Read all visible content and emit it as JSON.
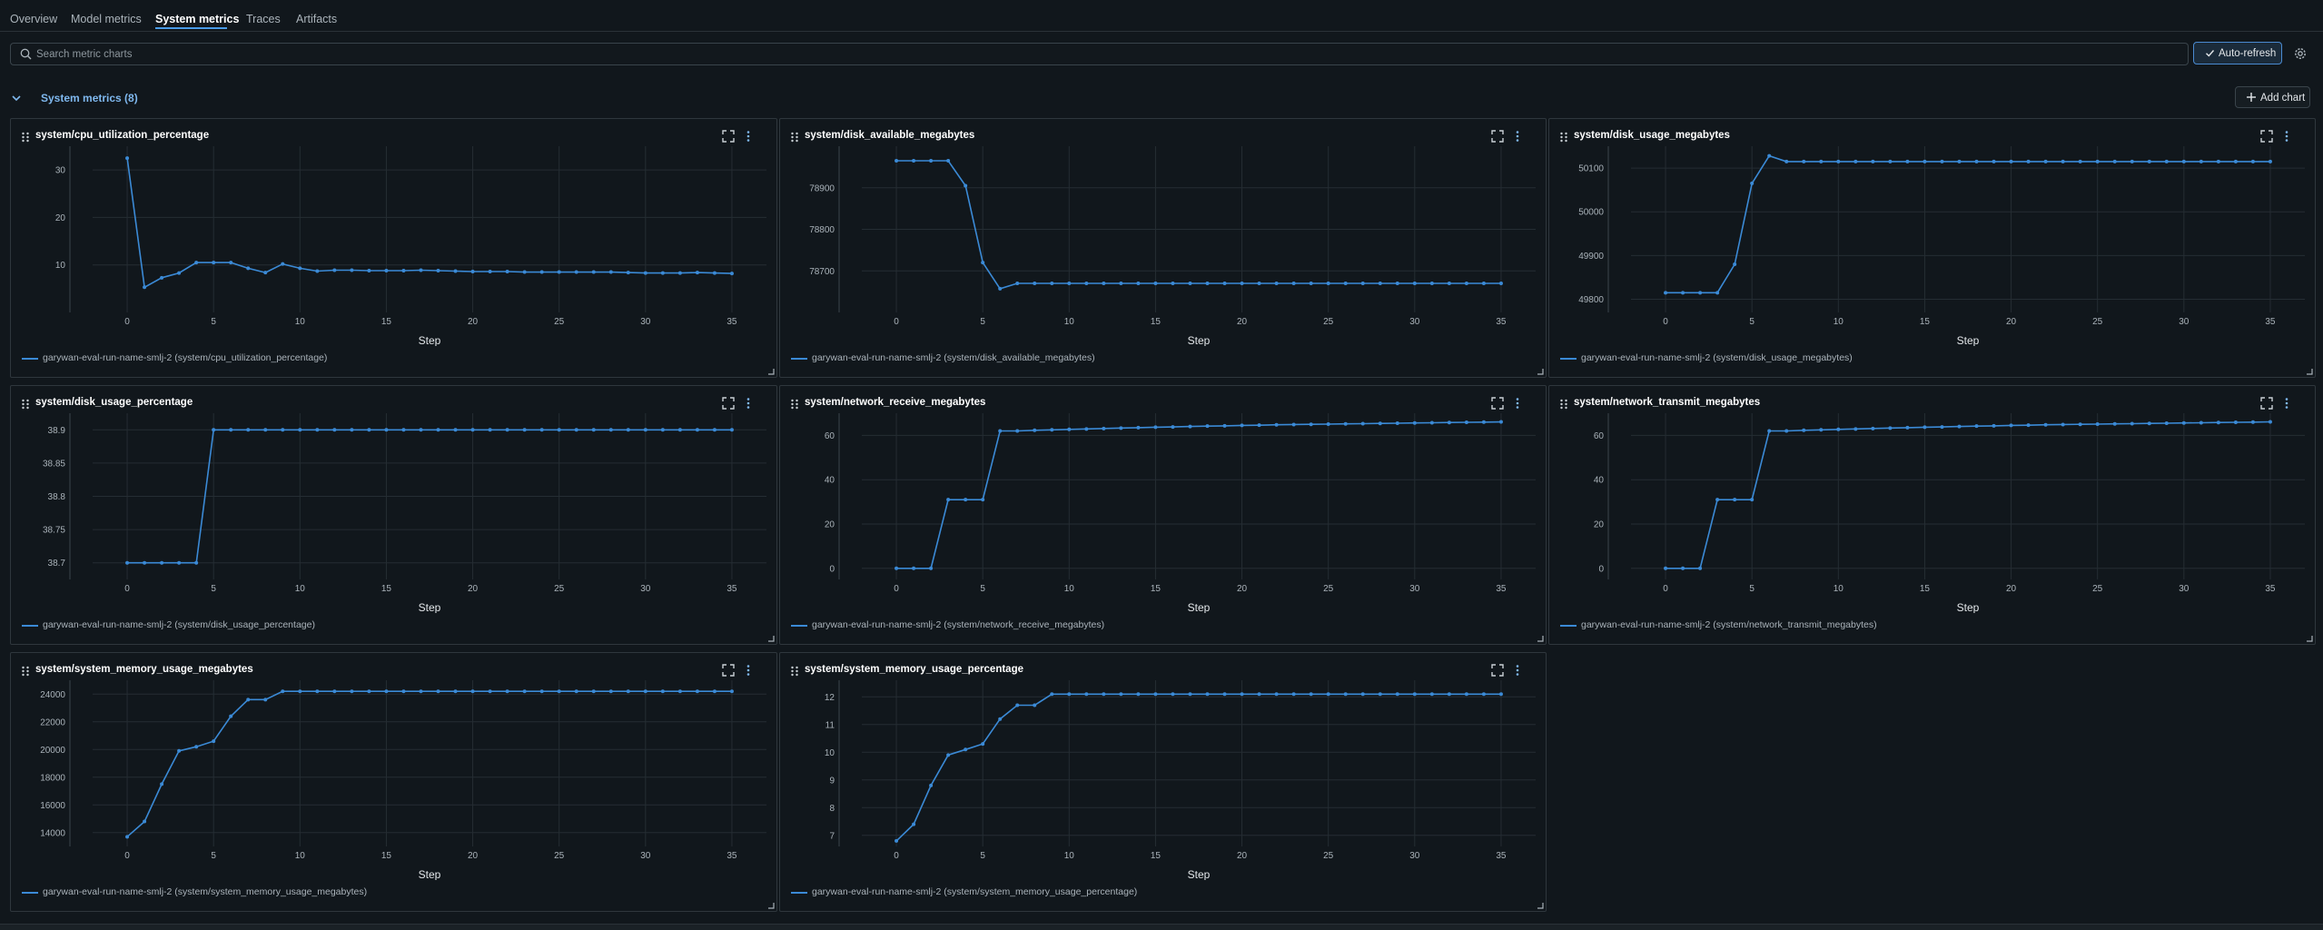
{
  "tabs": [
    {
      "label": "Overview",
      "active": false
    },
    {
      "label": "Model metrics",
      "active": false
    },
    {
      "label": "System metrics",
      "active": true
    },
    {
      "label": "Traces",
      "active": false
    },
    {
      "label": "Artifacts",
      "active": false
    }
  ],
  "search": {
    "placeholder": "Search metric charts",
    "value": ""
  },
  "toolbar": {
    "auto_refresh_label": "Auto-refresh",
    "auto_refresh_on": true
  },
  "section": {
    "title": "System metrics (8)",
    "expanded": true,
    "add_chart_label": "Add chart"
  },
  "colors": {
    "accent": "#4a9ce8",
    "series": "#3b8ad6",
    "background": "#11171c",
    "card_border": "#2f373d"
  },
  "charts": [
    {
      "title": "system/cpu_utilization_percentage",
      "chart_data": {
        "type": "line",
        "xlabel": "Step",
        "x_ticks": [
          0,
          5,
          10,
          15,
          20,
          25,
          30,
          35
        ],
        "y_ticks": [
          "10",
          "20",
          "30"
        ],
        "ylim": [
          0,
          35
        ],
        "xlim": [
          -2,
          37
        ],
        "series": [
          {
            "name": "garywan-eval-run-name-smlj-2 (system/cpu_utilization_percentage)",
            "x": [
              0,
              1,
              2,
              3,
              4,
              5,
              6,
              7,
              8,
              9,
              10,
              11,
              12,
              13,
              14,
              15,
              16,
              17,
              18,
              19,
              20,
              21,
              22,
              23,
              24,
              25,
              26,
              27,
              28,
              29,
              30,
              31,
              32,
              33,
              34,
              35
            ],
            "y": [
              32.5,
              5.3,
              7.3,
              8.3,
              10.5,
              10.5,
              10.5,
              9.3,
              8.4,
              10.2,
              9.3,
              8.7,
              8.9,
              8.9,
              8.8,
              8.8,
              8.8,
              8.9,
              8.8,
              8.7,
              8.6,
              8.6,
              8.6,
              8.5,
              8.5,
              8.5,
              8.5,
              8.5,
              8.5,
              8.4,
              8.3,
              8.3,
              8.3,
              8.4,
              8.3,
              8.2
            ]
          }
        ]
      }
    },
    {
      "title": "system/disk_available_megabytes",
      "chart_data": {
        "type": "line",
        "xlabel": "Step",
        "x_ticks": [
          0,
          5,
          10,
          15,
          20,
          25,
          30,
          35
        ],
        "y_ticks": [
          "78700",
          "78800",
          "78900"
        ],
        "ylim": [
          78600,
          79000
        ],
        "xlim": [
          -2,
          37
        ],
        "series": [
          {
            "name": "garywan-eval-run-name-smlj-2 (system/disk_available_megabytes)",
            "x": [
              0,
              1,
              2,
              3,
              4,
              5,
              6,
              7,
              8,
              9,
              10,
              11,
              12,
              13,
              14,
              15,
              16,
              17,
              18,
              19,
              20,
              21,
              22,
              23,
              24,
              25,
              26,
              27,
              28,
              29,
              30,
              31,
              32,
              33,
              34,
              35
            ],
            "y": [
              78965,
              78965,
              78965,
              78965,
              78905,
              78720,
              78657,
              78670,
              78670,
              78670,
              78670,
              78670,
              78670,
              78670,
              78670,
              78670,
              78670,
              78670,
              78670,
              78670,
              78670,
              78670,
              78670,
              78670,
              78670,
              78670,
              78670,
              78670,
              78670,
              78670,
              78670,
              78670,
              78670,
              78670,
              78670,
              78670
            ]
          }
        ]
      }
    },
    {
      "title": "system/disk_usage_megabytes",
      "chart_data": {
        "type": "line",
        "xlabel": "Step",
        "x_ticks": [
          0,
          5,
          10,
          15,
          20,
          25,
          30,
          35
        ],
        "y_ticks": [
          "49800",
          "49900",
          "50000",
          "50100"
        ],
        "ylim": [
          49770,
          50150
        ],
        "xlim": [
          -2,
          37
        ],
        "series": [
          {
            "name": "garywan-eval-run-name-smlj-2 (system/disk_usage_megabytes)",
            "x": [
              0,
              1,
              2,
              3,
              4,
              5,
              6,
              7,
              8,
              9,
              10,
              11,
              12,
              13,
              14,
              15,
              16,
              17,
              18,
              19,
              20,
              21,
              22,
              23,
              24,
              25,
              26,
              27,
              28,
              29,
              30,
              31,
              32,
              33,
              34,
              35
            ],
            "y": [
              49815,
              49815,
              49815,
              49815,
              49880,
              50065,
              50128,
              50115,
              50115,
              50115,
              50115,
              50115,
              50115,
              50115,
              50115,
              50115,
              50115,
              50115,
              50115,
              50115,
              50115,
              50115,
              50115,
              50115,
              50115,
              50115,
              50115,
              50115,
              50115,
              50115,
              50115,
              50115,
              50115,
              50115,
              50115,
              50115
            ]
          }
        ]
      }
    },
    {
      "title": "system/disk_usage_percentage",
      "chart_data": {
        "type": "line",
        "xlabel": "Step",
        "x_ticks": [
          0,
          5,
          10,
          15,
          20,
          25,
          30,
          35
        ],
        "y_ticks": [
          "38.7",
          "38.75",
          "38.8",
          "38.85",
          "38.9"
        ],
        "ylim": [
          38.675,
          38.925
        ],
        "xlim": [
          -2,
          37
        ],
        "series": [
          {
            "name": "garywan-eval-run-name-smlj-2 (system/disk_usage_percentage)",
            "x": [
              0,
              1,
              2,
              3,
              4,
              5,
              6,
              7,
              8,
              9,
              10,
              11,
              12,
              13,
              14,
              15,
              16,
              17,
              18,
              19,
              20,
              21,
              22,
              23,
              24,
              25,
              26,
              27,
              28,
              29,
              30,
              31,
              32,
              33,
              34,
              35
            ],
            "y": [
              38.7,
              38.7,
              38.7,
              38.7,
              38.7,
              38.9,
              38.9,
              38.9,
              38.9,
              38.9,
              38.9,
              38.9,
              38.9,
              38.9,
              38.9,
              38.9,
              38.9,
              38.9,
              38.9,
              38.9,
              38.9,
              38.9,
              38.9,
              38.9,
              38.9,
              38.9,
              38.9,
              38.9,
              38.9,
              38.9,
              38.9,
              38.9,
              38.9,
              38.9,
              38.9,
              38.9
            ]
          }
        ]
      }
    },
    {
      "title": "system/network_receive_megabytes",
      "chart_data": {
        "type": "line",
        "xlabel": "Step",
        "x_ticks": [
          0,
          5,
          10,
          15,
          20,
          25,
          30,
          35
        ],
        "y_ticks": [
          "0",
          "20",
          "40",
          "60"
        ],
        "ylim": [
          -5,
          70
        ],
        "xlim": [
          -2,
          37
        ],
        "series": [
          {
            "name": "garywan-eval-run-name-smlj-2 (system/network_receive_megabytes)",
            "x": [
              0,
              1,
              2,
              3,
              4,
              5,
              6,
              7,
              8,
              9,
              10,
              11,
              12,
              13,
              14,
              15,
              16,
              17,
              18,
              19,
              20,
              21,
              22,
              23,
              24,
              25,
              26,
              27,
              28,
              29,
              30,
              31,
              32,
              33,
              34,
              35
            ],
            "y": [
              0,
              0,
              0,
              31,
              31,
              31,
              62,
              62,
              62.3,
              62.5,
              62.7,
              62.9,
              63.1,
              63.3,
              63.5,
              63.7,
              63.8,
              64,
              64.2,
              64.3,
              64.5,
              64.6,
              64.8,
              64.9,
              65,
              65.1,
              65.2,
              65.3,
              65.4,
              65.5,
              65.6,
              65.7,
              65.8,
              65.9,
              66,
              66.1
            ]
          }
        ]
      }
    },
    {
      "title": "system/network_transmit_megabytes",
      "chart_data": {
        "type": "line",
        "xlabel": "Step",
        "x_ticks": [
          0,
          5,
          10,
          15,
          20,
          25,
          30,
          35
        ],
        "y_ticks": [
          "0",
          "20",
          "40",
          "60"
        ],
        "ylim": [
          -5,
          70
        ],
        "xlim": [
          -2,
          37
        ],
        "series": [
          {
            "name": "garywan-eval-run-name-smlj-2 (system/network_transmit_megabytes)",
            "x": [
              0,
              1,
              2,
              3,
              4,
              5,
              6,
              7,
              8,
              9,
              10,
              11,
              12,
              13,
              14,
              15,
              16,
              17,
              18,
              19,
              20,
              21,
              22,
              23,
              24,
              25,
              26,
              27,
              28,
              29,
              30,
              31,
              32,
              33,
              34,
              35
            ],
            "y": [
              0,
              0,
              0,
              31,
              31,
              31,
              62,
              62,
              62.3,
              62.5,
              62.7,
              62.9,
              63.1,
              63.3,
              63.5,
              63.7,
              63.8,
              64,
              64.2,
              64.3,
              64.5,
              64.6,
              64.8,
              64.9,
              65,
              65.1,
              65.2,
              65.3,
              65.4,
              65.5,
              65.6,
              65.7,
              65.8,
              65.9,
              66,
              66.1
            ]
          }
        ]
      }
    },
    {
      "title": "system/system_memory_usage_megabytes",
      "chart_data": {
        "type": "line",
        "xlabel": "Step",
        "x_ticks": [
          0,
          5,
          10,
          15,
          20,
          25,
          30,
          35
        ],
        "y_ticks": [
          "14000",
          "16000",
          "18000",
          "20000",
          "22000",
          "24000"
        ],
        "ylim": [
          13000,
          25000
        ],
        "xlim": [
          -2,
          37
        ],
        "series": [
          {
            "name": "garywan-eval-run-name-smlj-2 (system/system_memory_usage_megabytes)",
            "x": [
              0,
              1,
              2,
              3,
              4,
              5,
              6,
              7,
              8,
              9,
              10,
              11,
              12,
              13,
              14,
              15,
              16,
              17,
              18,
              19,
              20,
              21,
              22,
              23,
              24,
              25,
              26,
              27,
              28,
              29,
              30,
              31,
              32,
              33,
              34,
              35
            ],
            "y": [
              13700,
              14800,
              17500,
              19900,
              20200,
              20600,
              22400,
              23600,
              23600,
              24200,
              24200,
              24200,
              24200,
              24200,
              24200,
              24200,
              24200,
              24200,
              24200,
              24200,
              24200,
              24200,
              24200,
              24200,
              24200,
              24200,
              24200,
              24200,
              24200,
              24200,
              24200,
              24200,
              24200,
              24200,
              24200,
              24200
            ]
          }
        ]
      }
    },
    {
      "title": "system/system_memory_usage_percentage",
      "chart_data": {
        "type": "line",
        "xlabel": "Step",
        "x_ticks": [
          0,
          5,
          10,
          15,
          20,
          25,
          30,
          35
        ],
        "y_ticks": [
          "7",
          "8",
          "9",
          "10",
          "11",
          "12"
        ],
        "ylim": [
          6.6,
          12.6
        ],
        "xlim": [
          -2,
          37
        ],
        "series": [
          {
            "name": "garywan-eval-run-name-smlj-2 (system/system_memory_usage_percentage)",
            "x": [
              0,
              1,
              2,
              3,
              4,
              5,
              6,
              7,
              8,
              9,
              10,
              11,
              12,
              13,
              14,
              15,
              16,
              17,
              18,
              19,
              20,
              21,
              22,
              23,
              24,
              25,
              26,
              27,
              28,
              29,
              30,
              31,
              32,
              33,
              34,
              35
            ],
            "y": [
              6.8,
              7.4,
              8.8,
              9.9,
              10.1,
              10.3,
              11.2,
              11.7,
              11.7,
              12.1,
              12.1,
              12.1,
              12.1,
              12.1,
              12.1,
              12.1,
              12.1,
              12.1,
              12.1,
              12.1,
              12.1,
              12.1,
              12.1,
              12.1,
              12.1,
              12.1,
              12.1,
              12.1,
              12.1,
              12.1,
              12.1,
              12.1,
              12.1,
              12.1,
              12.1,
              12.1
            ]
          }
        ]
      }
    }
  ]
}
